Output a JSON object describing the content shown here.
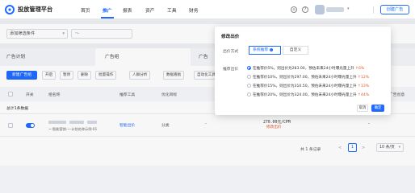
{
  "header": {
    "app_title": "投放管理平台",
    "nav": [
      "首页",
      "推广",
      "报表",
      "资产",
      "工具",
      "财务"
    ],
    "active_nav": "推广",
    "create_button": "创建广告"
  },
  "filters": {
    "filter_select": "添加筛选条件",
    "date_range": "～"
  },
  "tabs": [
    "广告计划",
    "广告组",
    "广告"
  ],
  "toolbar": {
    "new_ad": "新建广告组",
    "buttons": [
      "开启",
      "暂停",
      "删除",
      "批量操作",
      "人群分析",
      "数据看板",
      "自动化工具"
    ]
  },
  "table": {
    "headers": [
      "开关",
      "组名称",
      "推荐工具",
      "优化目标",
      "出价",
      "广告创意"
    ],
    "summary_label": "总计1条数据",
    "row": {
      "plan_text": "~-智能营销-~-计划名称示例-01",
      "recommend_link": "智能出价",
      "type": "分类",
      "dash": "-",
      "bid": "270.00元/CPM",
      "edit_link": "修改出价",
      "right_value": "-"
    }
  },
  "pagination": {
    "total": "共 1 条记录",
    "prev": "<",
    "current": "1",
    "next": ">",
    "page_size": "10 条/页"
  },
  "modal": {
    "title": "修改出价",
    "mode_label": "出价方式",
    "seg_options": [
      "系统推荐",
      "自定义"
    ],
    "seg_info": "i",
    "budget_label": "推荐出价",
    "options": [
      {
        "main": "在推荐价5%，则出价为283.00，预估未来24小时曝光量上升",
        "pct": "↑6%"
      },
      {
        "main": "在推荐价10%，则出价为297.00，预估未来24小时曝光量上升",
        "pct": "↑12%"
      },
      {
        "main": "在推荐价15%，则出价为310.50，预估未来24小时曝光量上升",
        "pct": "↑13%"
      },
      {
        "main": "在推荐价20%，则出价为324.00，预估未来24小时曝光量上升",
        "pct": "↑44%"
      }
    ],
    "selected_option": 0,
    "cancel": "取消",
    "confirm": "确定"
  },
  "colors": {
    "primary": "#1f6bff",
    "accent_red": "#e4532b"
  }
}
